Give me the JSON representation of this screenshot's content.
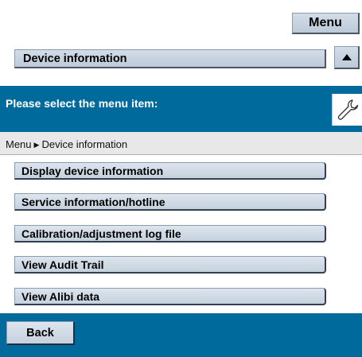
{
  "top": {
    "menu_label": "Menu",
    "device_info_label": "Device information"
  },
  "panel": {
    "title": "Please select the menu item:",
    "breadcrumb": {
      "root": "Menu",
      "current": "Device information"
    },
    "items": [
      {
        "label": "Display device information"
      },
      {
        "label": "Service information/hotline"
      },
      {
        "label": "Calibration/adjustment log file"
      },
      {
        "label": "View Audit Trail"
      },
      {
        "label": "View Alibi data"
      }
    ],
    "back_label": "Back"
  },
  "colors": {
    "accent_blue": "#006a9c",
    "button_grey": "#c5d1de",
    "breadcrumb_bg": "#e8e8e8"
  },
  "icons": [
    "triangle-up-icon",
    "wrench-icon",
    "breadcrumb-arrow-icon"
  ]
}
